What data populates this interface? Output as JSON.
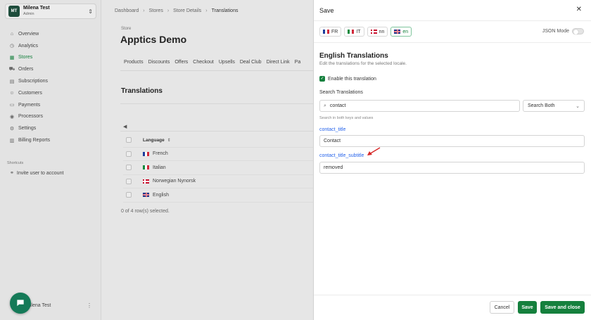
{
  "sidebar": {
    "user": {
      "initials": "MT",
      "name": "Milena Test",
      "role": "Admin"
    },
    "nav": [
      {
        "label": "Overview",
        "icon": "home-icon",
        "glyph": "⌂"
      },
      {
        "label": "Analytics",
        "icon": "clock-icon",
        "glyph": "◷"
      },
      {
        "label": "Stores",
        "icon": "store-icon",
        "glyph": "▦"
      },
      {
        "label": "Orders",
        "icon": "cart-icon",
        "glyph": "⛟"
      },
      {
        "label": "Subscriptions",
        "icon": "calendar-icon",
        "glyph": "▤"
      },
      {
        "label": "Customers",
        "icon": "users-icon",
        "glyph": "☺"
      },
      {
        "label": "Payments",
        "icon": "card-icon",
        "glyph": "▭"
      },
      {
        "label": "Processors",
        "icon": "processor-icon",
        "glyph": "◉"
      },
      {
        "label": "Settings",
        "icon": "gear-icon",
        "glyph": "⚙"
      },
      {
        "label": "Billing Reports",
        "icon": "report-icon",
        "glyph": "▥"
      }
    ],
    "active_nav": "Stores",
    "shortcuts_label": "Shortcuts",
    "shortcut_item": "Invite user to account",
    "bottom_user_name": "Milena Test"
  },
  "main": {
    "breadcrumb": [
      "Dashboard",
      "Stores",
      "Store Details",
      "Translations"
    ],
    "store_kicker": "Store",
    "store_title": "Apptics Demo",
    "tabs": [
      "Products",
      "Discounts",
      "Offers",
      "Checkout",
      "Upsells",
      "Deal Club",
      "Direct Link",
      "Pa"
    ],
    "section_title": "Translations",
    "table_header": "Language",
    "languages": [
      {
        "name": "French",
        "flag": "fr"
      },
      {
        "name": "Italian",
        "flag": "it"
      },
      {
        "name": "Norwegian Nynorsk",
        "flag": "no"
      },
      {
        "name": "English",
        "flag": "gb"
      }
    ],
    "rows_selected": "0 of 4 row(s) selected."
  },
  "drawer": {
    "title": "Save",
    "locale_tabs": [
      {
        "label": "FR",
        "flag": "fr"
      },
      {
        "label": "IT",
        "flag": "it"
      },
      {
        "label": "nn",
        "flag": "no"
      },
      {
        "label": "en",
        "flag": "gb"
      }
    ],
    "active_locale": "en",
    "json_mode_label": "JSON Mode",
    "translations_title": "English Translations",
    "translations_subtitle": "Edit the translations for the selected locale.",
    "enable_label": "Enable this translation",
    "search_label": "Search Translations",
    "search_value": "contact",
    "search_scope": "Search Both",
    "search_hint": "Search in both keys and values",
    "fields": [
      {
        "key": "contact_title",
        "value": "Contact"
      },
      {
        "key": "contact_title_subtitle",
        "value": "removed"
      }
    ],
    "buttons": {
      "cancel": "Cancel",
      "save": "Save",
      "save_close": "Save and close"
    }
  },
  "colors": {
    "accent": "#15803d",
    "key_link": "#2563eb",
    "annotation_arrow": "#d62828"
  }
}
